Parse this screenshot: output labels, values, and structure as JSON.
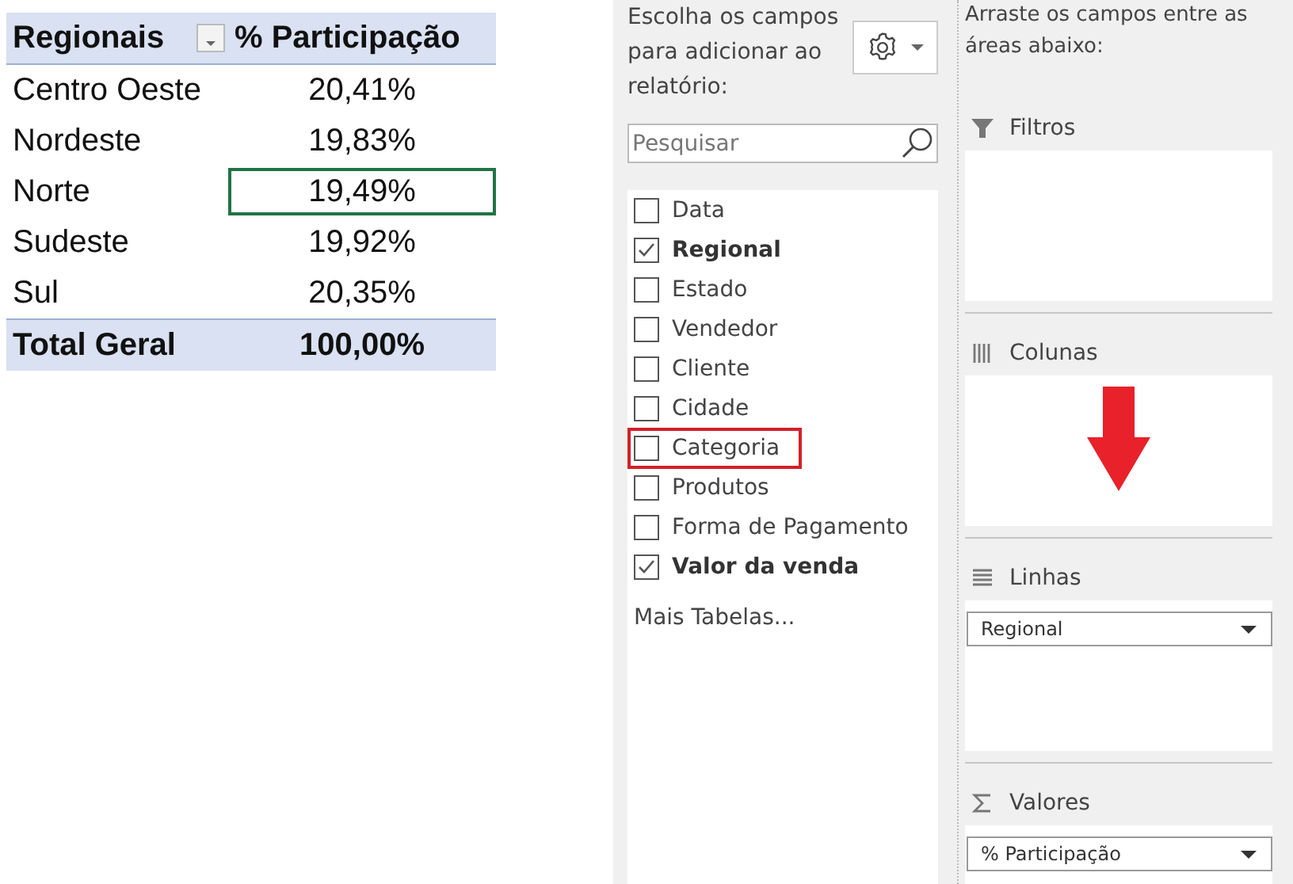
{
  "pivot_table": {
    "columns": [
      "Regionais",
      "% Participação"
    ],
    "rows": [
      {
        "label": "Centro Oeste",
        "value": "20,41%",
        "selected": false
      },
      {
        "label": "Nordeste",
        "value": "19,83%",
        "selected": false
      },
      {
        "label": "Norte",
        "value": "19,49%",
        "selected": true
      },
      {
        "label": "Sudeste",
        "value": "19,92%",
        "selected": false
      },
      {
        "label": "Sul",
        "value": "20,35%",
        "selected": false
      }
    ],
    "total": {
      "label": "Total Geral",
      "value": "100,00%"
    }
  },
  "field_list": {
    "instruction": "Escolha os campos para adicionar ao relatório:",
    "search": {
      "placeholder": "Pesquisar"
    },
    "fields": [
      {
        "label": "Data",
        "checked": false,
        "highlighted": false
      },
      {
        "label": "Regional",
        "checked": true,
        "highlighted": false
      },
      {
        "label": "Estado",
        "checked": false,
        "highlighted": false
      },
      {
        "label": "Vendedor",
        "checked": false,
        "highlighted": false
      },
      {
        "label": "Cliente",
        "checked": false,
        "highlighted": false
      },
      {
        "label": "Cidade",
        "checked": false,
        "highlighted": false
      },
      {
        "label": "Categoria",
        "checked": false,
        "highlighted": true
      },
      {
        "label": "Produtos",
        "checked": false,
        "highlighted": false
      },
      {
        "label": "Forma de Pagamento",
        "checked": false,
        "highlighted": false
      },
      {
        "label": "Valor da venda",
        "checked": true,
        "highlighted": false
      }
    ],
    "more_tables": "Mais Tabelas..."
  },
  "areas_panel": {
    "instruction": "Arraste os campos entre as áreas abaixo:",
    "areas": [
      {
        "kind": "filters",
        "title": "Filtros",
        "drop_arrow": false
      },
      {
        "kind": "columns",
        "title": "Colunas",
        "drop_arrow": true
      },
      {
        "kind": "rows",
        "title": "Linhas",
        "items": [
          "Regional"
        ],
        "drop_arrow": false
      },
      {
        "kind": "values",
        "title": "Valores",
        "items": [
          "% Participação"
        ],
        "drop_arrow": false
      }
    ]
  }
}
